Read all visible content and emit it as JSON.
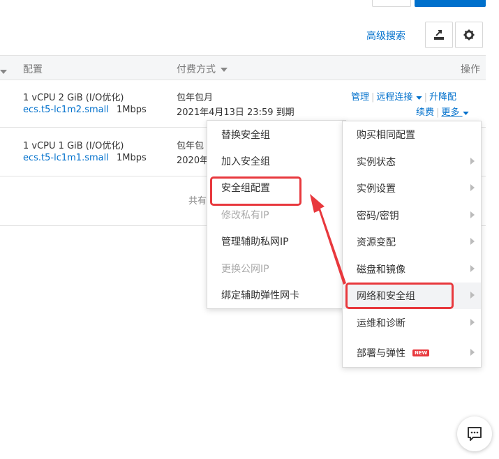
{
  "toolbar": {
    "advanced_search": "高级搜索",
    "export_icon": "export-icon",
    "settings_icon": "gear-icon"
  },
  "table": {
    "columns": [
      "配置",
      "付费方式",
      "操作"
    ],
    "rows": [
      {
        "spec": "1 vCPU 2 GiB (I/O优化)",
        "type_link": "ecs.t5-lc1m2.small",
        "bandwidth": "1Mbps",
        "billing": "包年包月",
        "expire": "2021年4月13日 23:59 到期",
        "actions": [
          "管理",
          "远程连接",
          "升降配",
          "续费",
          "更多"
        ]
      },
      {
        "spec": "1 vCPU 1 GiB (I/O优化)",
        "type_link": "ecs.t5-lc1m1.small",
        "bandwidth": "1Mbps",
        "billing": "包年包",
        "expire": "2020年"
      }
    ],
    "footer_text": "共有"
  },
  "more_menu": {
    "items": [
      {
        "label": "购买相同配置",
        "submenu": false
      },
      {
        "label": "实例状态",
        "submenu": true
      },
      {
        "label": "实例设置",
        "submenu": true
      },
      {
        "label": "密码/密钥",
        "submenu": true
      },
      {
        "label": "资源变配",
        "submenu": true
      },
      {
        "label": "磁盘和镜像",
        "submenu": true
      },
      {
        "label": "网络和安全组",
        "submenu": true,
        "highlighted": true
      },
      {
        "label": "运维和诊断",
        "submenu": true
      },
      {
        "label": "部署与弹性",
        "submenu": true,
        "badge": "NEW"
      }
    ]
  },
  "network_submenu": {
    "items": [
      {
        "label": "替换安全组",
        "disabled": false
      },
      {
        "label": "加入安全组",
        "disabled": false
      },
      {
        "label": "安全组配置",
        "disabled": false,
        "highlighted": true
      },
      {
        "label": "修改私有IP",
        "disabled": true
      },
      {
        "label": "管理辅助私网IP",
        "disabled": false
      },
      {
        "label": "更换公网IP",
        "disabled": true
      },
      {
        "label": "绑定辅助弹性网卡",
        "disabled": false
      }
    ]
  },
  "colors": {
    "link": "#0070cc",
    "highlight": "#e8383d",
    "header_bg": "#f5f6f7"
  }
}
